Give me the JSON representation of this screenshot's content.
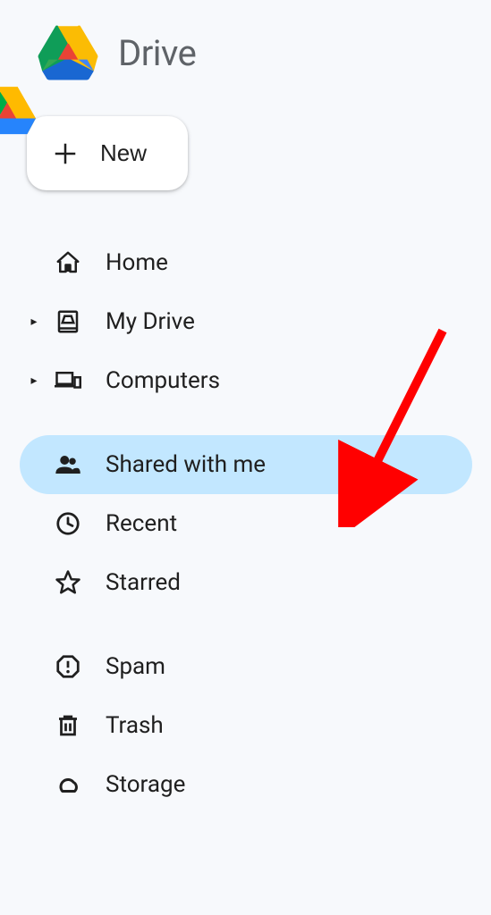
{
  "app": {
    "title": "Drive"
  },
  "new_button": {
    "label": "New"
  },
  "nav": {
    "group1": [
      {
        "label": "Home",
        "icon": "home",
        "expand": false
      },
      {
        "label": "My Drive",
        "icon": "my-drive",
        "expand": true
      },
      {
        "label": "Computers",
        "icon": "computers",
        "expand": true
      }
    ],
    "group2": [
      {
        "label": "Shared with me",
        "icon": "shared",
        "selected": true
      },
      {
        "label": "Recent",
        "icon": "recent"
      },
      {
        "label": "Starred",
        "icon": "starred"
      }
    ],
    "group3": [
      {
        "label": "Spam",
        "icon": "spam"
      },
      {
        "label": "Trash",
        "icon": "trash"
      },
      {
        "label": "Storage",
        "icon": "storage"
      }
    ]
  }
}
